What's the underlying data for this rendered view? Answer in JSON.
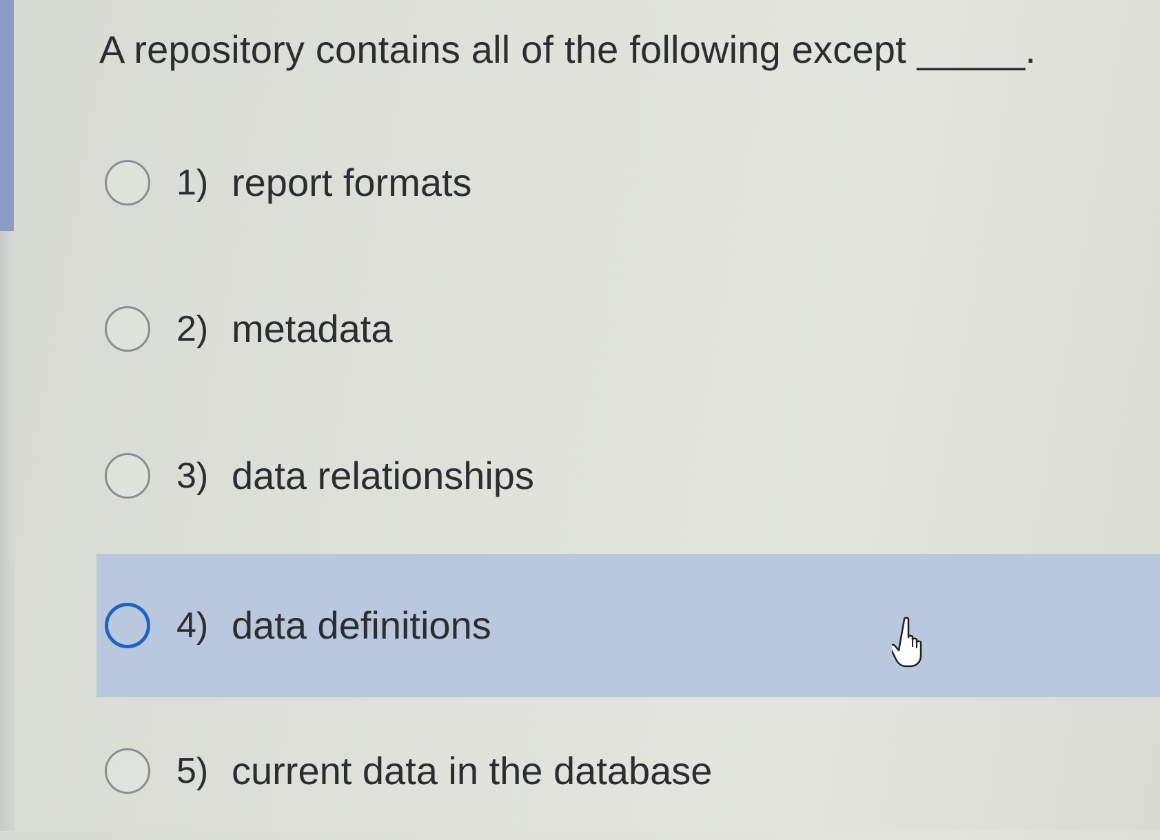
{
  "question": {
    "text": "A repository contains all of the following except _____."
  },
  "options": [
    {
      "number": "1)",
      "label": "report formats",
      "hovered": false
    },
    {
      "number": "2)",
      "label": "metadata",
      "hovered": false
    },
    {
      "number": "3)",
      "label": "data relationships",
      "hovered": false
    },
    {
      "number": "4)",
      "label": "data definitions",
      "hovered": true
    },
    {
      "number": "5)",
      "label": "current data in the database",
      "hovered": false
    }
  ],
  "cursor": {
    "icon": "hand-pointer-icon"
  },
  "colors": {
    "hover_background": "#b9c8dd",
    "radio_hover_border": "#1d62c7",
    "radio_border": "#8a8e90",
    "left_accent": "#8d9bc2"
  }
}
